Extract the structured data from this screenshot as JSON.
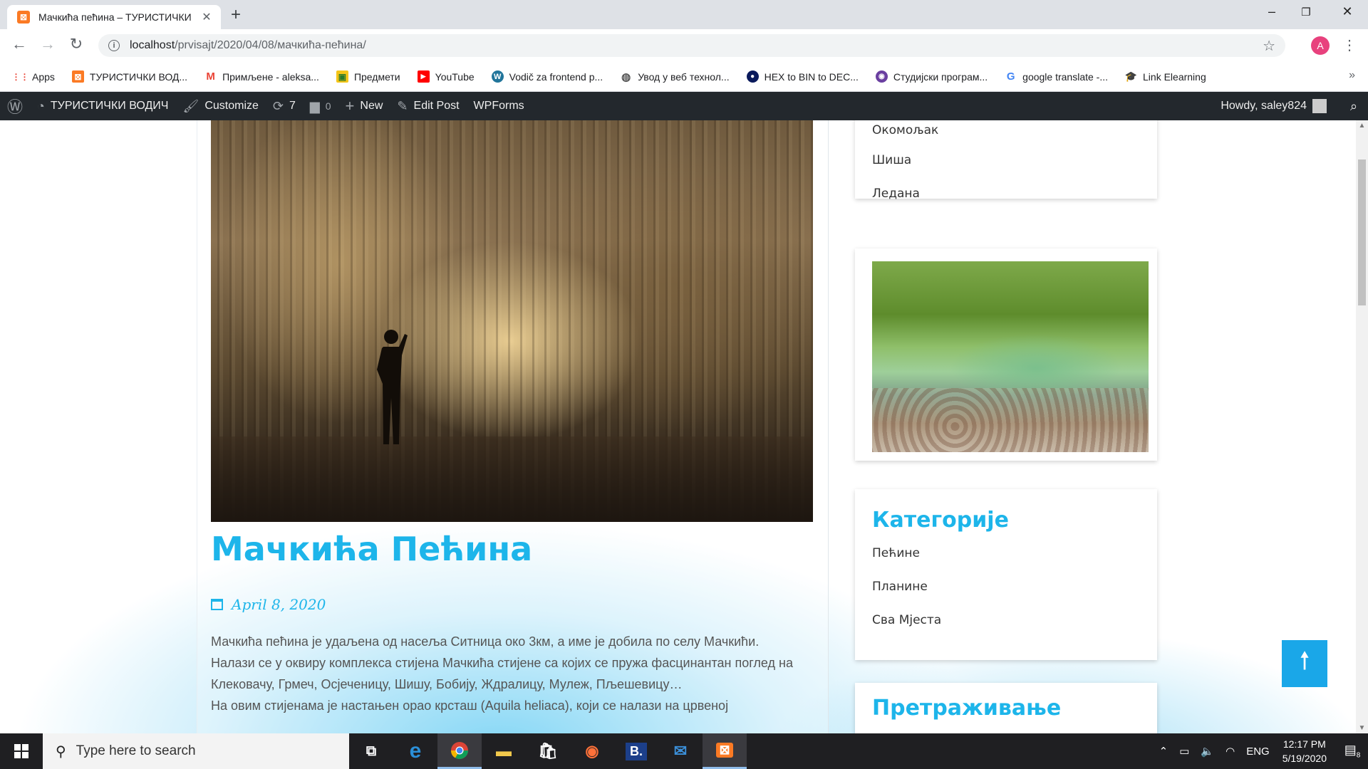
{
  "browser": {
    "tab_title": "Мачкића пећина – ТУРИСТИЧКИ",
    "tab_favicon": "xampp-icon",
    "new_tab_symbol": "+",
    "url_host": "localhost",
    "url_path": "/prvisajt/2020/04/08/мачкића-пећина/",
    "profile_initial": "A",
    "window_controls": {
      "minimize": "–",
      "maximize": "❐",
      "close": "✕"
    }
  },
  "bookmarks": [
    {
      "label": "Apps",
      "icon": "apps-grid-icon",
      "color": "#ea4335"
    },
    {
      "label": "ТУРИСТИЧКИ ВОД...",
      "icon": "xampp-icon",
      "color": "#fb7a24"
    },
    {
      "label": "Примљене - aleksa...",
      "icon": "gmail-icon",
      "color": "#ea4335"
    },
    {
      "label": "Предмети",
      "icon": "folder-icon",
      "color": "#f5c518"
    },
    {
      "label": "YouTube",
      "icon": "youtube-icon",
      "color": "#ff0000"
    },
    {
      "label": "Vodič za frontend p...",
      "icon": "wordpress-icon",
      "color": "#21759b"
    },
    {
      "label": "Увод у веб технол...",
      "icon": "globe-icon",
      "color": "#555555"
    },
    {
      "label": "HEX to BIN to DEC...",
      "icon": "hex-icon",
      "color": "#0a1a5c"
    },
    {
      "label": "Студијски програм...",
      "icon": "university-icon",
      "color": "#6a3fa0"
    },
    {
      "label": "google translate -...",
      "icon": "google-icon",
      "color": "#4285f4"
    },
    {
      "label": "Link Elearning",
      "icon": "elearning-icon",
      "color": "#d94f2b"
    }
  ],
  "adminbar": {
    "site_name": "ТУРИСТИЧКИ ВОДИЧ",
    "customize": "Customize",
    "updates_count": "7",
    "comments_count": "0",
    "new": "New",
    "edit_post": "Edit Post",
    "wpforms": "WPForms",
    "howdy": "Howdy, saley824"
  },
  "post": {
    "title": "Мачкића Пећина",
    "date": "April 8, 2020",
    "paragraphs": [
      "Мачкића пећина је удаљена од насеља Ситница око 3км, а име је добила по селу Мачкићи.",
      "Налази се у оквиру комплекса стијена Мачкића стијене са којих се пружа фасцинантан поглед на Клековачу, Грмеч, Осјеченицу, Шишу, Бобију, Ждралицу, Мулеж, Пљешевицу…",
      "На овим стијенама је настањен орао крсташ (Аquila heliaca), који се налази на црвеној"
    ]
  },
  "sidebar": {
    "places": [
      "Окомољак",
      "Шиша",
      "Ледана"
    ],
    "categories_title": "Категорије",
    "categories": [
      "Пећине",
      "Планине",
      "Сва Мјеста"
    ],
    "search_title": "Претраживање"
  },
  "scroll_top_symbol": "🠕",
  "taskbar": {
    "search_placeholder": "Type here to search",
    "apps": [
      "task-view-icon",
      "edge-icon",
      "chrome-icon",
      "file-explorer-icon",
      "store-icon",
      "firefox-icon",
      "b-app-icon",
      "mail-icon",
      "xampp-icon"
    ],
    "language": "ENG",
    "time": "12:17 PM",
    "date": "5/19/2020",
    "notification_count": "8"
  }
}
